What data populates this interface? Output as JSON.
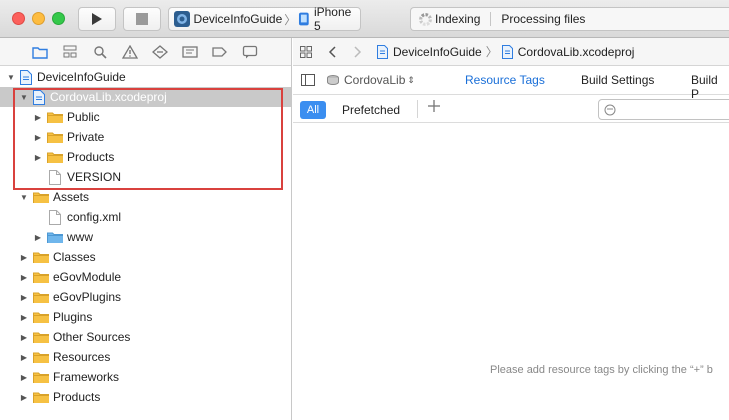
{
  "toolbar": {
    "scheme": {
      "project": "DeviceInfoGuide",
      "device": "iPhone 5"
    },
    "activity": {
      "status": "Indexing",
      "detail": "Processing files"
    }
  },
  "navigator": {
    "tree": [
      {
        "label": "DeviceInfoGuide",
        "kind": "project",
        "expanded": true,
        "level": 0
      },
      {
        "label": "CordovaLib.xcodeproj",
        "kind": "project",
        "expanded": true,
        "level": 1,
        "selected": true
      },
      {
        "label": "Public",
        "kind": "folder",
        "expanded": false,
        "level": 2
      },
      {
        "label": "Private",
        "kind": "folder",
        "expanded": false,
        "level": 2
      },
      {
        "label": "Products",
        "kind": "folder",
        "expanded": false,
        "level": 2
      },
      {
        "label": "VERSION",
        "kind": "file",
        "level": 2
      },
      {
        "label": "Assets",
        "kind": "folder",
        "expanded": true,
        "level": 1
      },
      {
        "label": "config.xml",
        "kind": "file",
        "level": 2
      },
      {
        "label": "www",
        "kind": "bluefolder",
        "expanded": false,
        "level": 2
      },
      {
        "label": "Classes",
        "kind": "folder",
        "expanded": false,
        "level": 1
      },
      {
        "label": "eGovModule",
        "kind": "folder",
        "expanded": false,
        "level": 1
      },
      {
        "label": "eGovPlugins",
        "kind": "folder",
        "expanded": false,
        "level": 1
      },
      {
        "label": "Plugins",
        "kind": "folder",
        "expanded": false,
        "level": 1
      },
      {
        "label": "Other Sources",
        "kind": "folder",
        "expanded": false,
        "level": 1
      },
      {
        "label": "Resources",
        "kind": "folder",
        "expanded": false,
        "level": 1
      },
      {
        "label": "Frameworks",
        "kind": "folder",
        "expanded": false,
        "level": 1
      },
      {
        "label": "Products",
        "kind": "folder",
        "expanded": false,
        "level": 1
      }
    ]
  },
  "editor": {
    "breadcrumb": {
      "project": "DeviceInfoGuide",
      "file": "CordovaLib.xcodeproj"
    },
    "target": "CordovaLib",
    "tabs": {
      "resource_tags": "Resource Tags",
      "build_settings": "Build Settings",
      "build_phases": "Build P"
    },
    "filters": {
      "all": "All",
      "prefetched": "Prefetched"
    },
    "empty_message": "Please add resource tags by clicking the “+” b"
  },
  "colors": {
    "accent": "#3b8ef0",
    "selection": "#c9c9c9",
    "highlight": "#d9413e",
    "folder": "#f6c143"
  }
}
